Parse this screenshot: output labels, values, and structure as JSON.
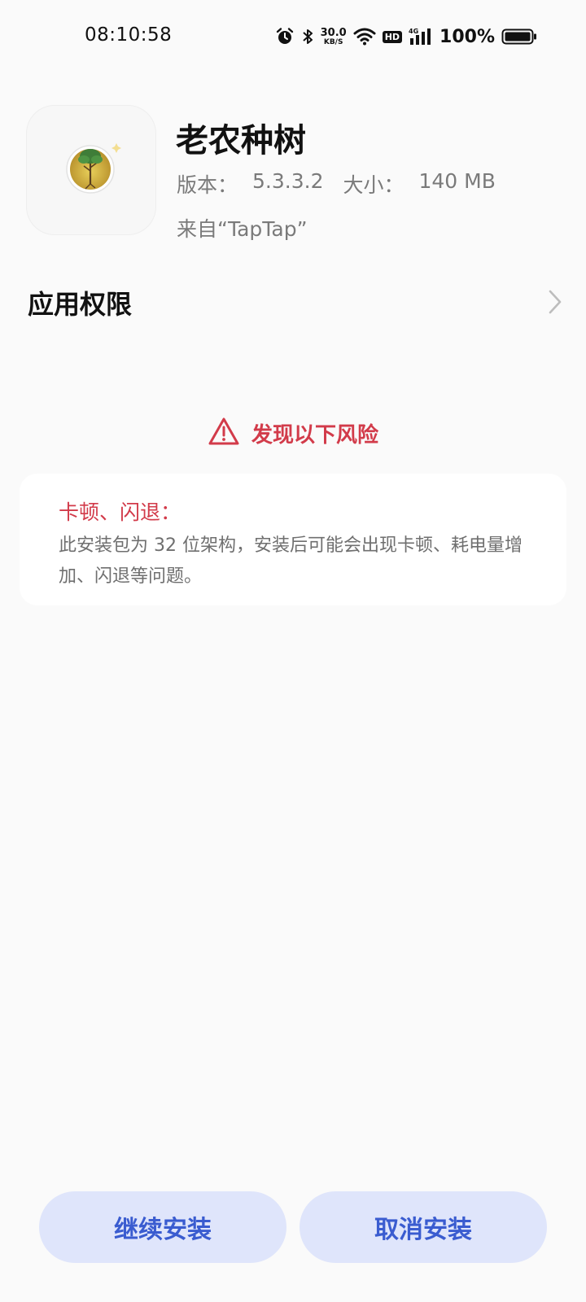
{
  "status_bar": {
    "time": "08:10:58",
    "net_speed_value": "30.0",
    "net_speed_unit": "KB/S",
    "hd_label": "HD",
    "network_type": "4G",
    "battery_percent": "100%"
  },
  "app": {
    "name": "老农种树",
    "version_label": "版本：",
    "version_value": "5.3.3.2",
    "size_label": "大小：",
    "size_value": "140 MB",
    "source": "来自“TapTap”"
  },
  "permissions": {
    "label": "应用权限"
  },
  "risk": {
    "heading": "发现以下风险",
    "title": "卡顿、闪退：",
    "description": "此安装包为 32 位架构，安装后可能会出现卡顿、耗电量增加、闪退等问题。"
  },
  "buttons": {
    "continue_label": "继续安装",
    "cancel_label": "取消安装"
  },
  "colors": {
    "background": "#fafafa",
    "risk_red": "#d23b4a",
    "button_bg": "#dfe5fb",
    "button_text": "#3a5cd0"
  }
}
